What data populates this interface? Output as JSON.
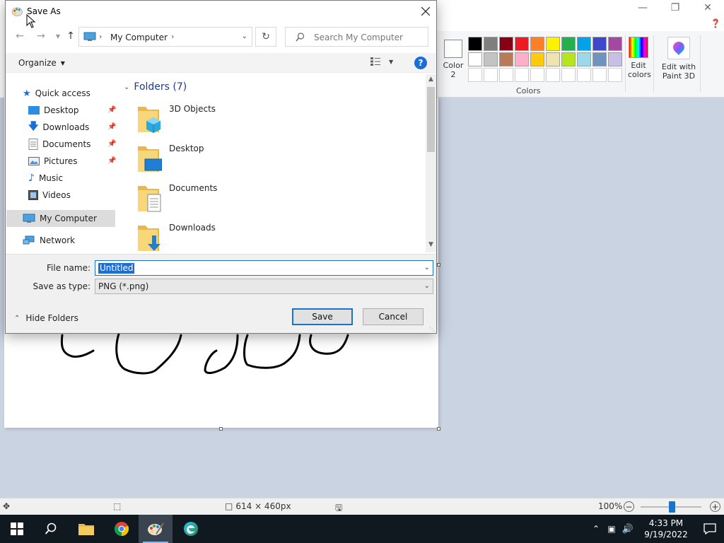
{
  "paint": {
    "color2_label": "Color\n2",
    "color2_line1": "Color",
    "color2_line2": "2",
    "colors_label": "Colors",
    "edit_colors_line1": "Edit",
    "edit_colors_line2": "colors",
    "paint3d_line1": "Edit with",
    "paint3d_line2": "Paint 3D",
    "palette_row1": [
      "#000000",
      "#7f7f7f",
      "#880015",
      "#ed1c24",
      "#ff7f27",
      "#fff200",
      "#22b14c",
      "#00a2e8",
      "#3f48cc",
      "#a349a4"
    ],
    "palette_row2": [
      "#ffffff",
      "#c3c3c3",
      "#b97a57",
      "#ffaec9",
      "#ffc90e",
      "#efe4b0",
      "#b5e61d",
      "#99d9ea",
      "#7092be",
      "#c8bfe7"
    ],
    "palette_row3": [
      "#ffffff",
      "#ffffff",
      "#ffffff",
      "#ffffff",
      "#ffffff",
      "#ffffff",
      "#ffffff",
      "#ffffff",
      "#ffffff",
      "#ffffff"
    ],
    "status": {
      "canvas_size": "614 × 460px",
      "zoom": "100%"
    }
  },
  "dialog": {
    "title": "Save As",
    "address_crumb": "My Computer",
    "search_placeholder": "Search My Computer",
    "organize_label": "Organize",
    "help_label": "?",
    "nav": {
      "quick_access": "Quick access",
      "items": [
        {
          "label": "Desktop"
        },
        {
          "label": "Downloads"
        },
        {
          "label": "Documents"
        },
        {
          "label": "Pictures"
        },
        {
          "label": "Music"
        },
        {
          "label": "Videos"
        }
      ],
      "my_computer": "My Computer",
      "network": "Network"
    },
    "folders_header": "Folders (7)",
    "folders": [
      {
        "name": "3D Objects"
      },
      {
        "name": "Desktop"
      },
      {
        "name": "Documents"
      },
      {
        "name": "Downloads"
      }
    ],
    "file_name_label": "File name:",
    "file_name_value": "Untitled",
    "save_type_label": "Save as type:",
    "save_type_value": "PNG (*.png)",
    "hide_folders_label": "Hide Folders",
    "save_button": "Save",
    "cancel_button": "Cancel"
  },
  "taskbar": {
    "time": "4:33 PM",
    "date": "9/19/2022"
  }
}
